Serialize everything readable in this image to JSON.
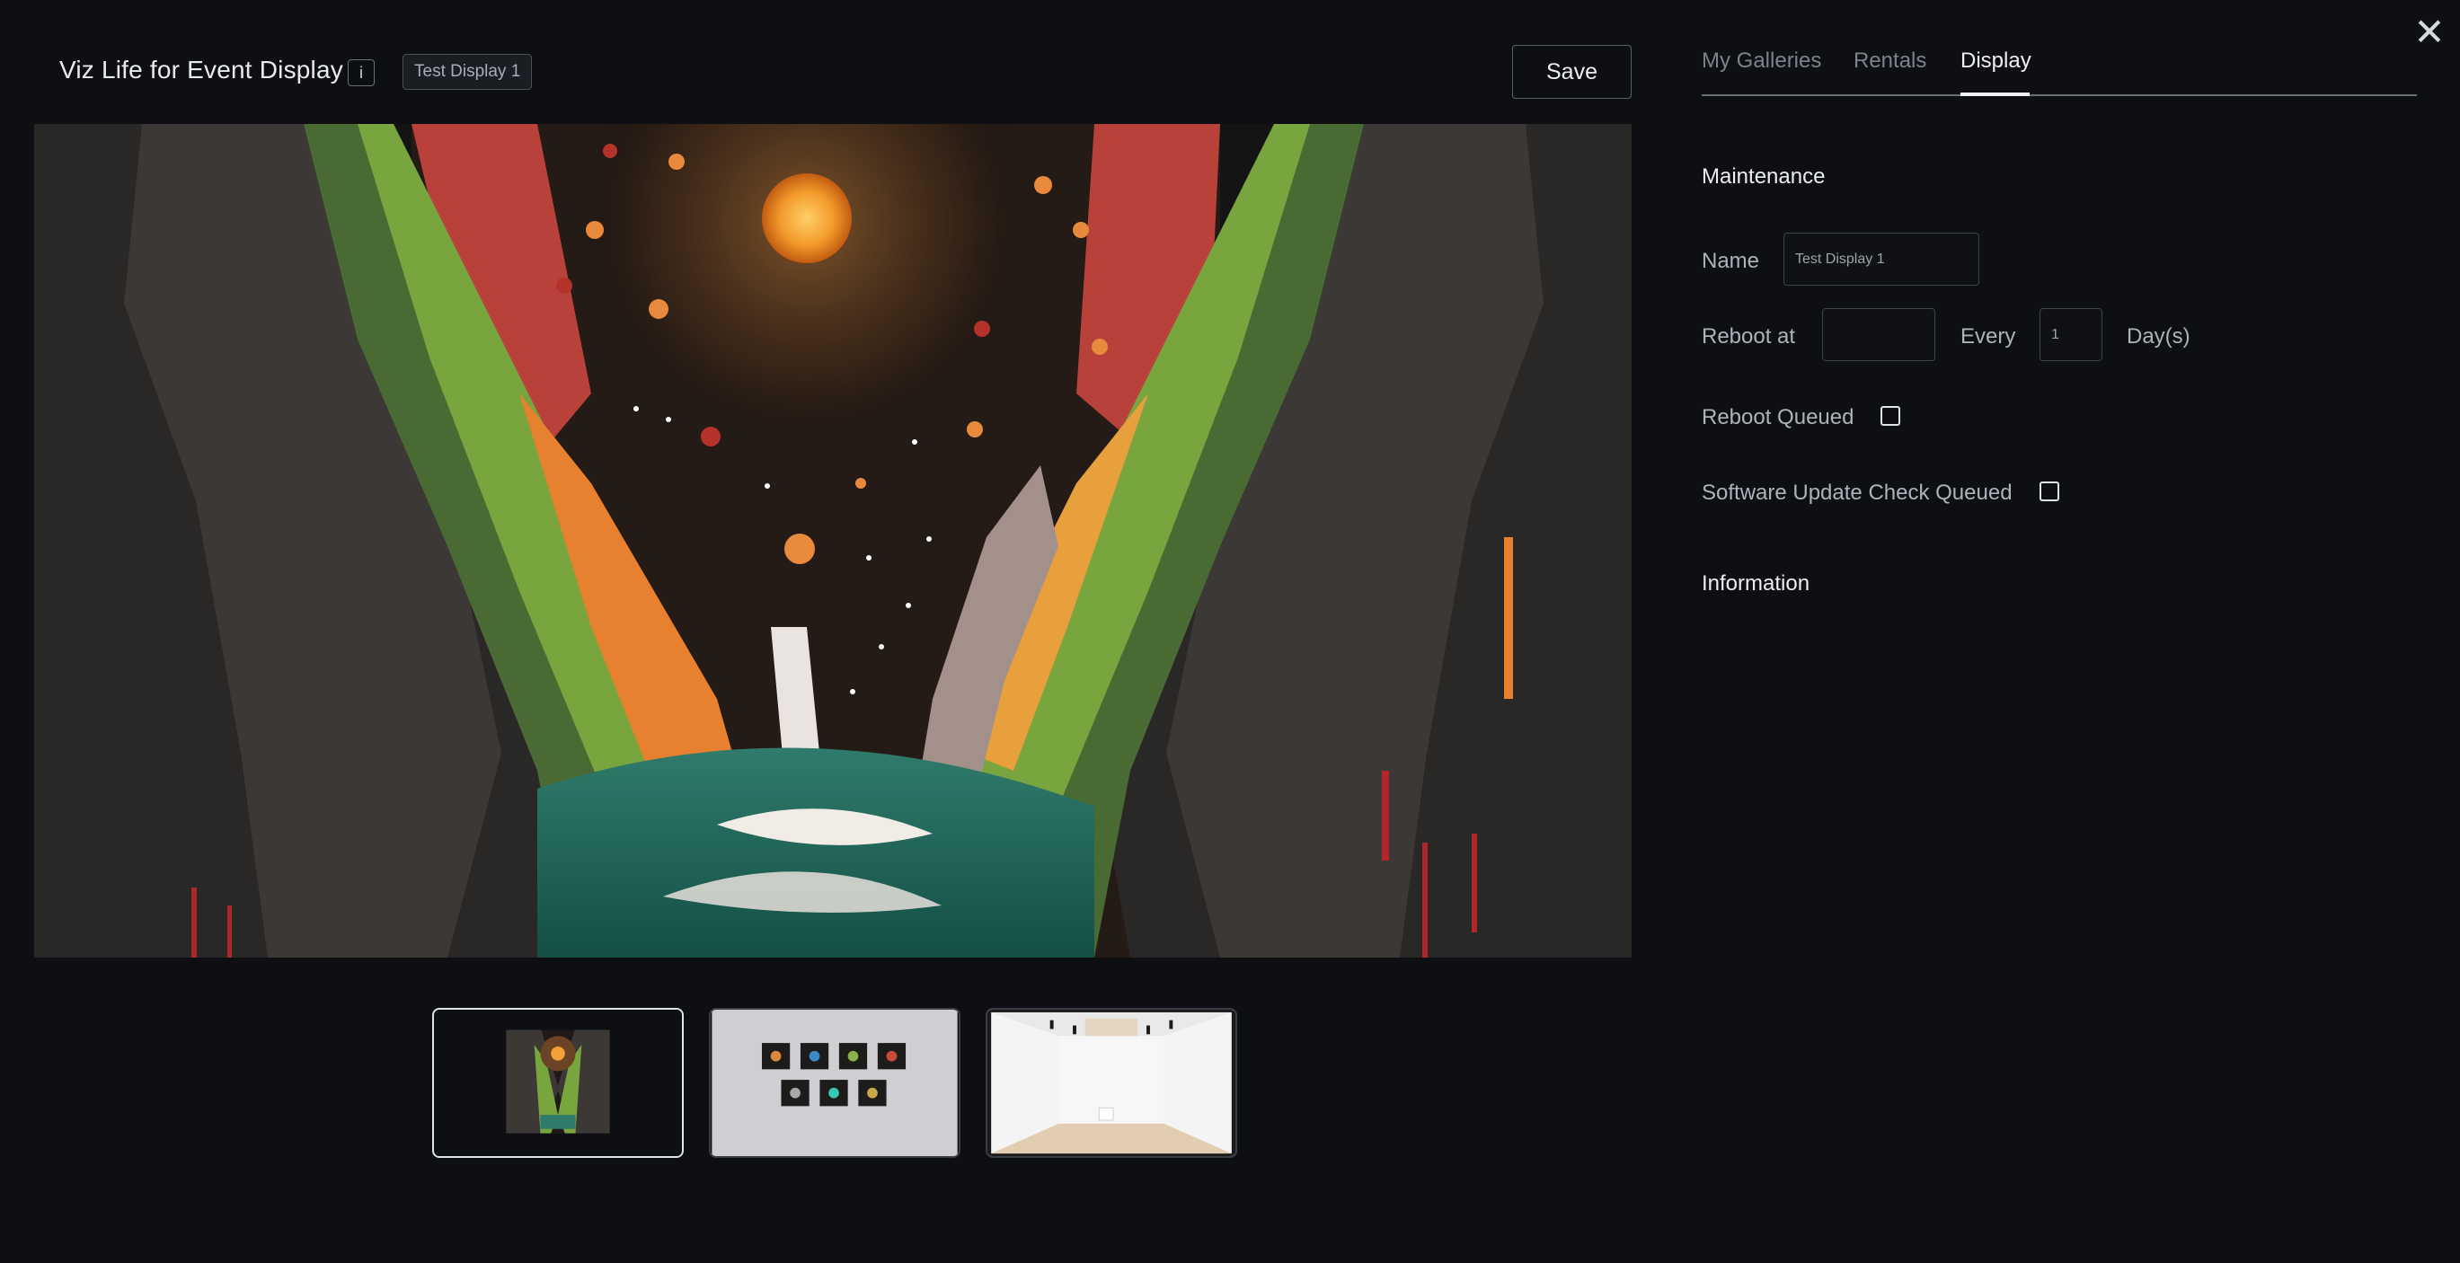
{
  "header": {
    "title": "Viz Life for Event Display",
    "info_label": "i",
    "display_badge": "Test Display 1",
    "save_label": "Save"
  },
  "close_symbol": "✕",
  "tabs": [
    {
      "label": "My Galleries",
      "active": false
    },
    {
      "label": "Rentals",
      "active": false
    },
    {
      "label": "Display",
      "active": true
    }
  ],
  "maintenance": {
    "heading": "Maintenance",
    "name_label": "Name",
    "name_value": "Test Display 1",
    "reboot_label": "Reboot at",
    "reboot_value": "",
    "every_label": "Every",
    "every_value": "1",
    "days_label": "Day(s)",
    "reboot_queued_label": "Reboot Queued",
    "reboot_queued_checked": false,
    "software_update_label": "Software Update Check Queued",
    "software_update_checked": false
  },
  "information": {
    "heading": "Information"
  },
  "thumbnails": [
    {
      "name": "artwork-thumbnail",
      "active": true
    },
    {
      "name": "grid-wall-thumbnail",
      "active": false
    },
    {
      "name": "gallery-room-thumbnail",
      "active": false
    }
  ],
  "colors": {
    "background": "#0d0f12",
    "text_primary": "#eceef2",
    "text_muted": "#7d828c",
    "border": "#3e424a"
  }
}
